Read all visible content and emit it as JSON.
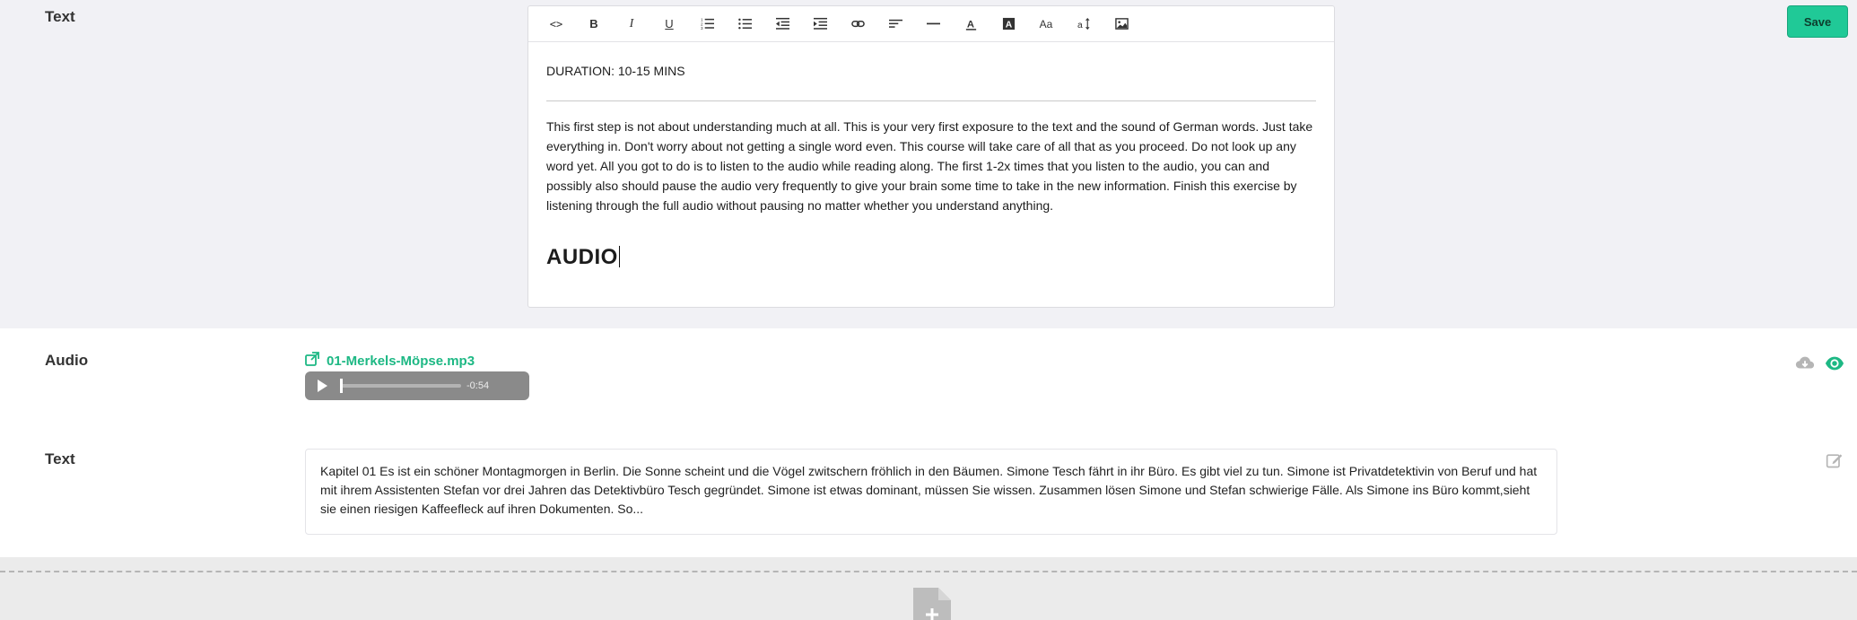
{
  "editor_section": {
    "label": "Text",
    "toolbar": [
      {
        "name": "source-code-icon",
        "glyph": "<>"
      },
      {
        "name": "bold-icon",
        "glyph": "B"
      },
      {
        "name": "italic-icon",
        "glyph": "I"
      },
      {
        "name": "underline-icon",
        "glyph": "U"
      },
      {
        "name": "ordered-list-icon",
        "glyph": ""
      },
      {
        "name": "unordered-list-icon",
        "glyph": ""
      },
      {
        "name": "outdent-icon",
        "glyph": ""
      },
      {
        "name": "indent-icon",
        "glyph": ""
      },
      {
        "name": "link-icon",
        "glyph": ""
      },
      {
        "name": "align-icon",
        "glyph": ""
      },
      {
        "name": "horizontal-rule-icon",
        "glyph": ""
      },
      {
        "name": "font-color-icon",
        "glyph": "A"
      },
      {
        "name": "background-color-icon",
        "glyph": "A"
      },
      {
        "name": "font-size-icon",
        "glyph": "Aa"
      },
      {
        "name": "line-height-icon",
        "glyph": "a"
      },
      {
        "name": "image-icon",
        "glyph": ""
      }
    ],
    "content": {
      "duration": "DURATION: 10-15 MINS",
      "paragraph": "This first step is not about understanding much at all. This is your very first exposure to the text and the sound of German words. Just take everything in. Don't worry about not getting a single word even. This course will take care of all that as you proceed. Do not look up any word yet. All you got to do is to listen to the audio while reading along. The first 1-2x times that you listen to the audio, you can and possibly also should pause the audio very frequently to give your brain some time to take in the new information. Finish this exercise by listening through the full audio without pausing no matter whether you understand anything.",
      "heading": "AUDIO"
    },
    "save_label": "Save"
  },
  "audio_section": {
    "label": "Audio",
    "file_name": "01-Merkels-Möpse.mp3",
    "time_remaining": "-0:54",
    "progress": 0.0
  },
  "text_section": {
    "label": "Text",
    "preview": "Kapitel 01 Es ist ein schöner Montagmorgen in Berlin. Die Sonne scheint und die Vögel zwitschern fröhlich in den Bäumen. Simone Tesch fährt in ihr Büro. Es gibt viel zu tun. Simone ist Privatdetektivin von Beruf und hat mit ihrem Assistenten Stefan vor drei Jahren das Detektivbüro Tesch gegründet. Simone ist etwas dominant, müssen Sie wissen. Zusammen lösen Simone und Stefan schwierige Fälle. Als Simone ins Büro kommt,sieht sie einen riesigen Kaffeefleck auf ihren Dokumenten. So..."
  },
  "colors": {
    "accent": "#20c997",
    "link": "#1db884"
  }
}
